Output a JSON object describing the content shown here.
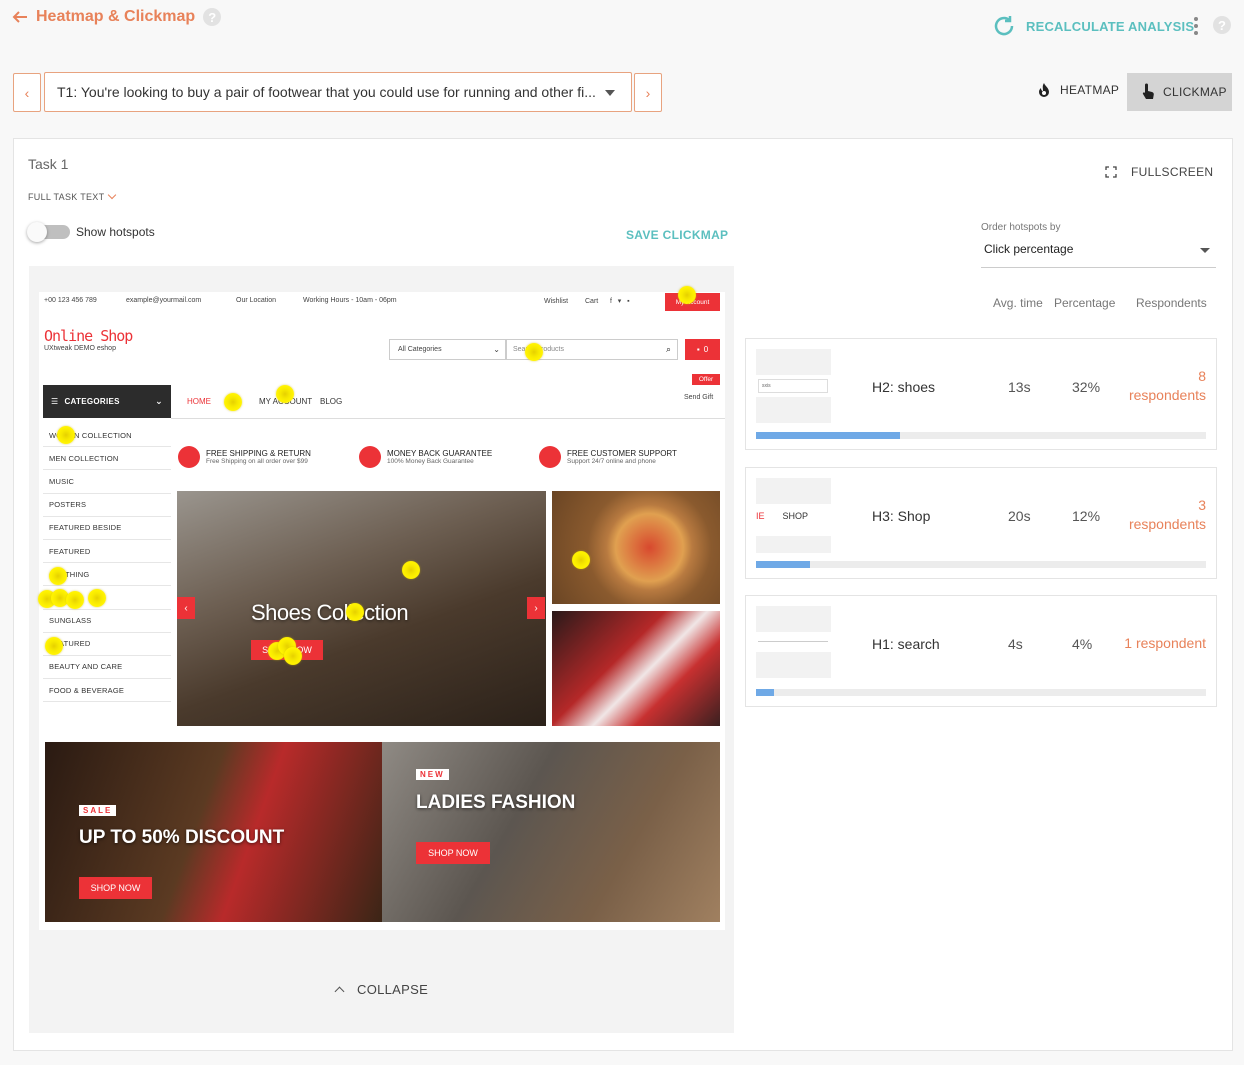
{
  "header": {
    "title": "Heatmap & Clickmap",
    "help": "?",
    "recalculate_label": "RECALCULATE ANALYSIS"
  },
  "task_selector": {
    "prev": "‹",
    "next": "›",
    "value": "T1: You're looking to buy a pair of footwear that you could use for running and other fi..."
  },
  "modes": {
    "heatmap_label": "HEATMAP",
    "clickmap_label": "CLICKMAP",
    "active": "clickmap"
  },
  "panel": {
    "task_title": "Task 1",
    "full_task_text": "FULL TASK TEXT",
    "fullscreen_label": "FULLSCREEN",
    "show_hotspots_label": "Show hotspots",
    "show_hotspots_on": false,
    "save_label": "SAVE CLICKMAP",
    "order_label": "Order hotspots by",
    "order_value": "Click percentage",
    "col_avg_time": "Avg. time",
    "col_percentage": "Percentage",
    "col_respondents": "Respondents",
    "collapse_label": "COLLAPSE"
  },
  "shop": {
    "phone": "+00 123 456 789",
    "email": "example@yourmail.com",
    "location": "Our Location",
    "hours": "Working Hours - 10am - 06pm",
    "wishlist": "Wishlist",
    "cart": "Cart",
    "my_account_btn": "My Account",
    "logo": "Online Shop",
    "logo_sub": "UXtweak DEMO eshop",
    "all_categories": "All Categories",
    "search_placeholder": "Search products",
    "cart_count": "0",
    "categories_title": "CATEGORIES",
    "nav": [
      "HOME",
      "MY ACCOUNT",
      "BLOG"
    ],
    "offer": "Offer",
    "send_gift": "Send Gift",
    "categories": [
      "WOMEN COLLECTION",
      "MEN COLLECTION",
      "MUSIC",
      "POSTERS",
      "FEATURED BESIDE",
      "FEATURED",
      "CLOTHING",
      "",
      "SUNGLASS",
      "FEATURED",
      "BEAUTY AND CARE",
      "FOOD & BEVERAGE"
    ],
    "features": [
      {
        "title": "FREE SHIPPING & RETURN",
        "sub": "Free Shipping on all order over $99"
      },
      {
        "title": "MONEY BACK GUARANTEE",
        "sub": "100% Money Back Guarantee"
      },
      {
        "title": "FREE CUSTOMER SUPPORT",
        "sub": "Support 24/7 online and phone"
      }
    ],
    "hero_title": "Shoes Collection",
    "hero_btn": "SHOP NOW",
    "banner1_tag": "SALE",
    "banner1_title": "UP TO 50% DISCOUNT",
    "banner1_btn": "SHOP NOW",
    "banner2_tag": "NEW",
    "banner2_title": "LADIES FASHION",
    "banner2_btn": "SHOP NOW"
  },
  "hotspots": [
    {
      "name": "H2: shoes",
      "avg_time": "13s",
      "percentage": "32%",
      "respondents_count": "8",
      "respondents_label": "respondents",
      "share": 0.32,
      "thumb_text": "sxis"
    },
    {
      "name": "H3: Shop",
      "avg_time": "20s",
      "percentage": "12%",
      "respondents_count": "3",
      "respondents_label": "respondents",
      "share": 0.12,
      "thumb_text": "SHOP"
    },
    {
      "name": "H1: search",
      "avg_time": "4s",
      "percentage": "4%",
      "respondents_count": "",
      "respondents_label": "1 respondent",
      "share": 0.04,
      "thumb_text": ""
    }
  ],
  "colors": {
    "accent": "#e8825a",
    "teal": "#5bbfbf",
    "bar": "#6fa9e6",
    "shop_red": "#ec3237",
    "hotspot": "#fff200"
  }
}
